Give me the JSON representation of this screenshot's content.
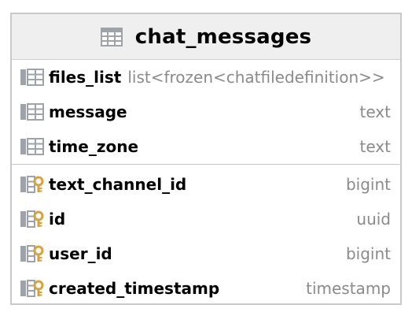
{
  "table": {
    "title": "chat_messages",
    "header_icon": "table-icon"
  },
  "fields": [
    {
      "name": "files_list",
      "type": "list<frozen<chatfiledefinition>>",
      "icon": "column-icon"
    },
    {
      "name": "message",
      "type": "text",
      "icon": "column-icon"
    },
    {
      "name": "time_zone",
      "type": "text",
      "icon": "column-icon"
    }
  ],
  "keys": [
    {
      "name": "text_channel_id",
      "type": "bigint",
      "icon": "key-column-icon"
    },
    {
      "name": "id",
      "type": "uuid",
      "icon": "key-column-icon"
    },
    {
      "name": "user_id",
      "type": "bigint",
      "icon": "key-column-icon"
    },
    {
      "name": "created_timestamp",
      "type": "timestamp",
      "icon": "key-column-icon"
    }
  ],
  "colors": {
    "header_bg": "#efefef",
    "border": "#c9c9c9",
    "type_text": "#8a8a8a",
    "icon_gray": "#9ea3aa",
    "key_gold": "#d7a23c"
  }
}
